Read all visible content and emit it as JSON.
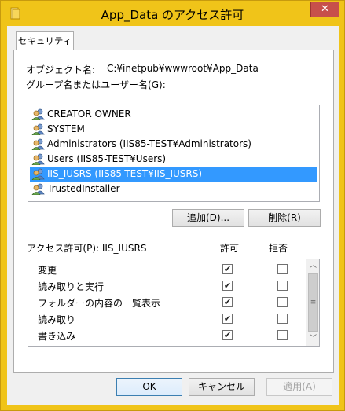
{
  "window": {
    "title": "App_Data のアクセス許可",
    "close_glyph": "✕"
  },
  "tab": {
    "label": "セキュリティ"
  },
  "object": {
    "label": "オブジェクト名:",
    "value": "C:¥inetpub¥wwwroot¥App_Data"
  },
  "group_label": "グループ名またはユーザー名(G):",
  "principals": [
    {
      "name": "CREATOR OWNER",
      "selected": false
    },
    {
      "name": "SYSTEM",
      "selected": false
    },
    {
      "name": "Administrators (IIS85-TEST¥Administrators)",
      "selected": false
    },
    {
      "name": "Users (IIS85-TEST¥Users)",
      "selected": false
    },
    {
      "name": "IIS_IUSRS (IIS85-TEST¥IIS_IUSRS)",
      "selected": true
    },
    {
      "name": "TrustedInstaller",
      "selected": false
    }
  ],
  "buttons": {
    "add": "追加(D)...",
    "remove": "削除(R)",
    "ok": "OK",
    "cancel": "キャンセル",
    "apply": "適用(A)"
  },
  "permissions": {
    "header_label": "アクセス許可(P): IIS_IUSRS",
    "allow_header": "許可",
    "deny_header": "拒否",
    "rows": [
      {
        "name": "変更",
        "allow": true,
        "deny": false
      },
      {
        "name": "読み取りと実行",
        "allow": true,
        "deny": false
      },
      {
        "name": "フォルダーの内容の一覧表示",
        "allow": true,
        "deny": false
      },
      {
        "name": "読み取り",
        "allow": true,
        "deny": false
      },
      {
        "name": "書き込み",
        "allow": true,
        "deny": false
      }
    ]
  },
  "scrollbar": {
    "up": "︿",
    "down": "﹀",
    "grip": "≡"
  },
  "colors": {
    "accent": "#f0c419",
    "selection": "#3399ff",
    "close": "#c7504b"
  }
}
